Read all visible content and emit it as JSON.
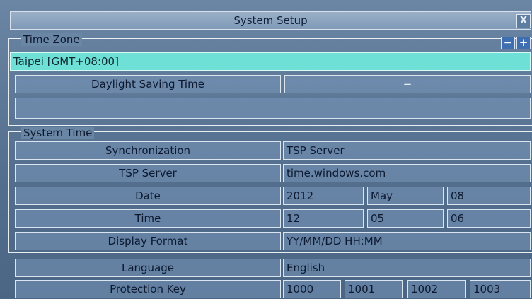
{
  "window": {
    "title": "System Setup",
    "close_label": "X"
  },
  "time_zone": {
    "label": "Time Zone",
    "minus_label": "−",
    "plus_label": "+",
    "value": "Taipei [GMT+08:00]",
    "dst_label": "Daylight Saving Time",
    "dst_value": "−",
    "extra_value": ""
  },
  "system_time": {
    "label": "System Time",
    "rows": [
      {
        "label": "Synchronization",
        "values": [
          "TSP Server"
        ]
      },
      {
        "label": "TSP Server",
        "values": [
          "time.windows.com"
        ]
      },
      {
        "label": "Date",
        "values": [
          "2012",
          "May",
          "08"
        ]
      },
      {
        "label": "Time",
        "values": [
          "12",
          "05",
          "06"
        ]
      },
      {
        "label": "Display Format",
        "values": [
          "YY/MM/DD HH:MM"
        ]
      }
    ]
  },
  "language": {
    "label": "Language",
    "value": "English"
  },
  "protection_key": {
    "label": "Protection Key",
    "values": [
      "1000",
      "1001",
      "1002",
      "1003"
    ]
  },
  "colors": {
    "accent": "#6fe0d6",
    "background": "#5d7896"
  }
}
